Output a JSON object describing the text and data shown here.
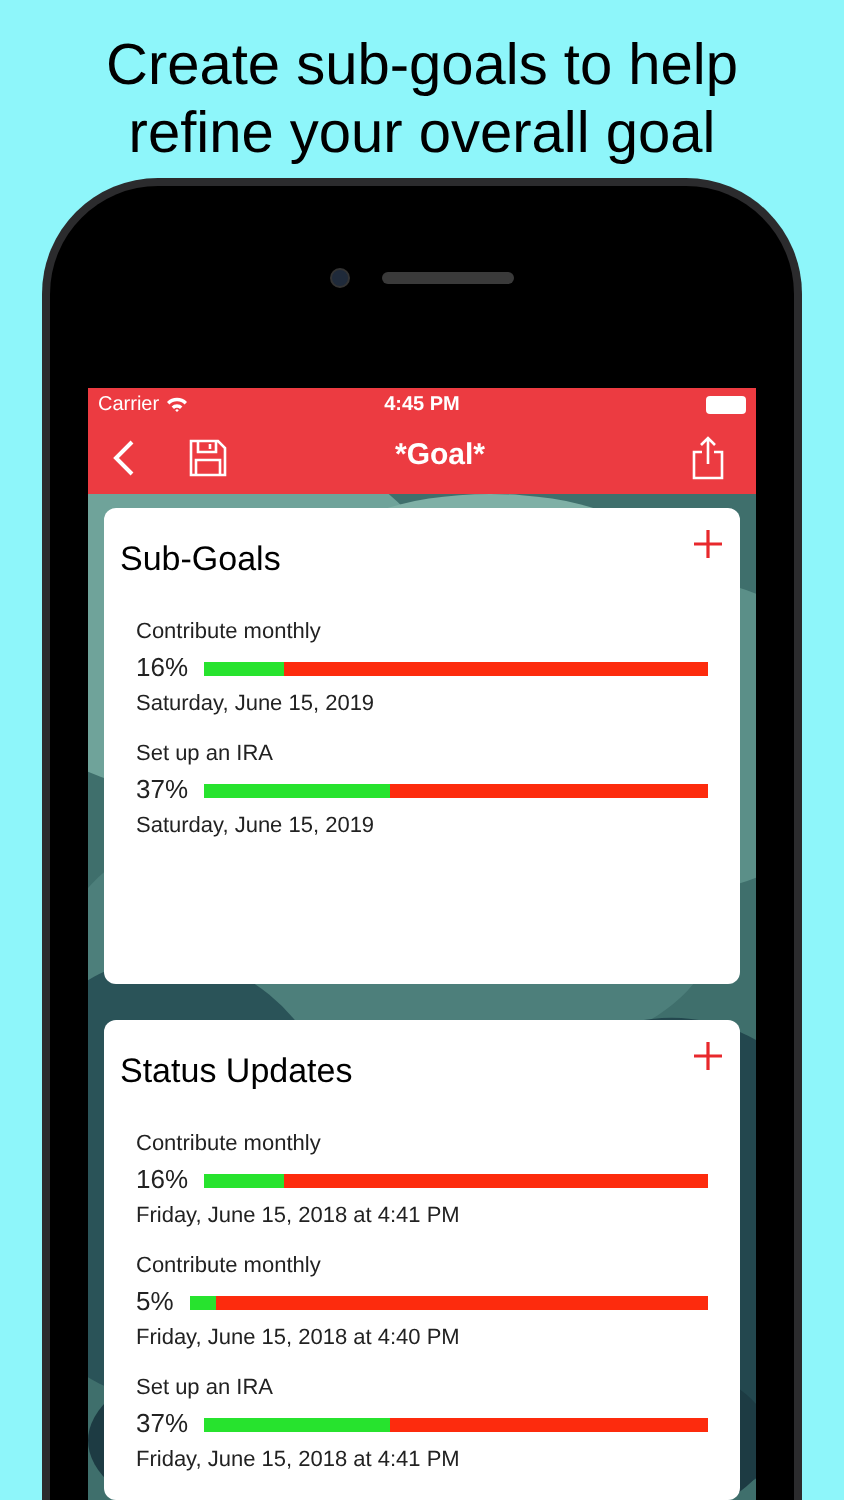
{
  "headline": "Create sub-goals to help\nrefine your overall goal",
  "status_bar": {
    "carrier": "Carrier",
    "time": "4:45 PM"
  },
  "nav_bar": {
    "title": "*Goal*"
  },
  "sections": [
    {
      "title": "Sub-Goals",
      "items": [
        {
          "name": "Contribute monthly",
          "percent": "16%",
          "level": 0.16,
          "date": "Saturday, June 15, 2019"
        },
        {
          "name": "Set up an IRA",
          "percent": "37%",
          "level": 0.37,
          "date": "Saturday, June 15, 2019"
        }
      ]
    },
    {
      "title": "Status Updates",
      "items": [
        {
          "name": "Contribute monthly",
          "percent": "16%",
          "level": 0.16,
          "date": "Friday, June 15, 2018 at 4:41 PM"
        },
        {
          "name": "Contribute monthly",
          "percent": "5%",
          "level": 0.05,
          "date": "Friday, June 15, 2018 at 4:40 PM"
        },
        {
          "name": "Set up an IRA",
          "percent": "37%",
          "level": 0.37,
          "date": "Friday, June 15, 2018 at 4:41 PM"
        }
      ]
    }
  ]
}
